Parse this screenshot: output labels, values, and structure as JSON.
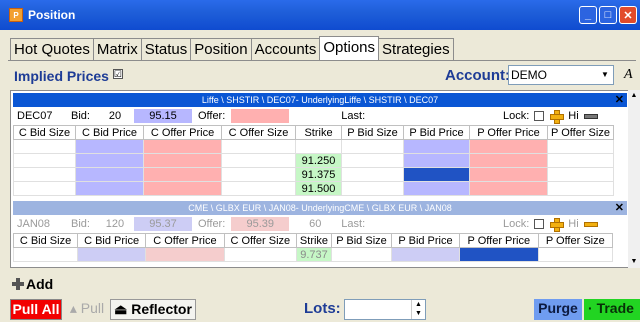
{
  "window": {
    "title": "Position",
    "app_icon": "app-icon",
    "buttons": [
      "minimize-icon",
      "maximize-icon",
      "close-icon"
    ]
  },
  "tabs": [
    "Hot Quotes",
    "Matrix",
    "Status",
    "Position",
    "Accounts",
    "Options",
    "Strategies"
  ],
  "active_tab": "Options",
  "implied": {
    "label": "Implied Prices",
    "checked": "☑"
  },
  "account": {
    "label": "Account:",
    "value": "DEMO",
    "font_icon": "A"
  },
  "products": [
    {
      "header": "Liffe \\ SHSTIR \\ DEC07- UnderlyingLiffe \\ SHSTIR \\ DEC07",
      "contract": "DEC07",
      "bid_label": "Bid:",
      "bid_size": "20",
      "bid_price": "95.15",
      "offer_label": "Offer:",
      "offer_size": "",
      "offer_price": "",
      "last_label": "Last:",
      "last_value": "",
      "lock_label": "Lock:",
      "hi_label": "Hi",
      "columns": [
        "C Bid Size",
        "C Bid Price",
        "C Offer Price",
        "C Offer Size",
        "Strike",
        "P Bid Size",
        "P Bid Price",
        "P Offer Price",
        "P Offer Size"
      ],
      "strikes": [
        "",
        "91.250",
        "91.375",
        "91.500"
      ]
    },
    {
      "header": "CME \\ GLBX EUR \\ JAN08- UnderlyingCME \\ GLBX EUR \\ JAN08",
      "contract": "JAN08",
      "bid_label": "Bid:",
      "bid_size": "120",
      "bid_price": "95.37",
      "offer_label": "Offer:",
      "offer_price": "95.39",
      "offer_size": "60",
      "last_label": "Last:",
      "last_value": "",
      "lock_label": "Lock:",
      "hi_label": "Hi",
      "columns": [
        "C Bid Size",
        "C Bid Price",
        "C Offer Price",
        "C Offer Size",
        "Strike",
        "P Bid Size",
        "P Bid Price",
        "P Offer Price",
        "P Offer Size"
      ],
      "strikes": [
        "9.737"
      ]
    }
  ],
  "bottom": {
    "add": "Add",
    "pull_all": "Pull All",
    "pull": "Pull",
    "reflector": "Reflector",
    "lots_label": "Lots:",
    "lots_value": "",
    "purge": "Purge",
    "trade": "Trade"
  },
  "colors": {
    "title_bar": "#0f4bd0",
    "bid": "#b7b7ff",
    "offer": "#ffb0b0",
    "strike": "#c6f7c6",
    "pull_all": "#f20000",
    "trade": "#22d422",
    "purge": "#6f9cf0"
  }
}
